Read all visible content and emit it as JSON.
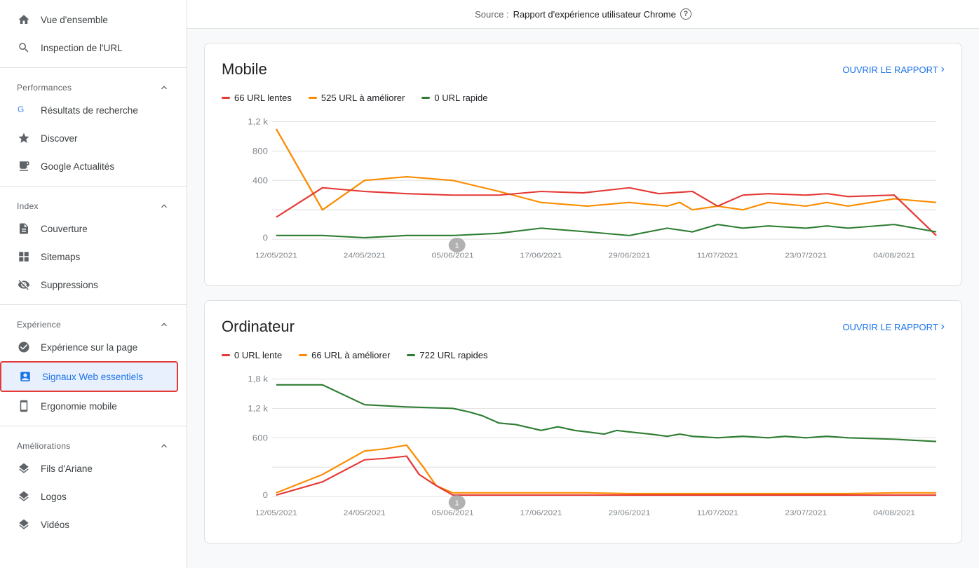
{
  "header": {
    "source_label": "Source :",
    "source_value": "Rapport d'expérience utilisateur Chrome",
    "help": "?"
  },
  "sidebar": {
    "items": [
      {
        "id": "vue-ensemble",
        "label": "Vue d'ensemble",
        "icon": "home",
        "section": null
      },
      {
        "id": "inspection-url",
        "label": "Inspection de l'URL",
        "icon": "search",
        "section": null
      },
      {
        "id": "section-performances",
        "label": "Performances",
        "type": "section"
      },
      {
        "id": "resultats-recherche",
        "label": "Résultats de recherche",
        "icon": "google",
        "section": "performances"
      },
      {
        "id": "discover",
        "label": "Discover",
        "icon": "star",
        "section": "performances"
      },
      {
        "id": "google-actualites",
        "label": "Google Actualités",
        "icon": "news",
        "section": "performances"
      },
      {
        "id": "section-index",
        "label": "Index",
        "type": "section"
      },
      {
        "id": "couverture",
        "label": "Couverture",
        "icon": "doc",
        "section": "index"
      },
      {
        "id": "sitemaps",
        "label": "Sitemaps",
        "icon": "grid",
        "section": "index"
      },
      {
        "id": "suppressions",
        "label": "Suppressions",
        "icon": "eye-off",
        "section": "index"
      },
      {
        "id": "section-experience",
        "label": "Expérience",
        "type": "section"
      },
      {
        "id": "experience-page",
        "label": "Expérience sur la page",
        "icon": "page",
        "section": "experience"
      },
      {
        "id": "signaux-web",
        "label": "Signaux Web essentiels",
        "icon": "vitals",
        "section": "experience",
        "active": true
      },
      {
        "id": "ergonomie-mobile",
        "label": "Ergonomie mobile",
        "icon": "mobile",
        "section": "experience"
      },
      {
        "id": "section-ameliorations",
        "label": "Améliorations",
        "type": "section"
      },
      {
        "id": "fils-ariane",
        "label": "Fils d'Ariane",
        "icon": "layers",
        "section": "ameliorations"
      },
      {
        "id": "logos",
        "label": "Logos",
        "icon": "layers",
        "section": "ameliorations"
      },
      {
        "id": "videos",
        "label": "Vidéos",
        "icon": "layers",
        "section": "ameliorations"
      }
    ]
  },
  "mobile_card": {
    "title": "Mobile",
    "open_report": "OUVRIR LE RAPPORT",
    "legend": [
      {
        "label": "66 URL lentes",
        "color": "#e53935"
      },
      {
        "label": "525 URL à améliorer",
        "color": "#fb8c00"
      },
      {
        "label": "0 URL rapide",
        "color": "#2e7d32"
      }
    ],
    "y_labels": [
      "1,2 k",
      "800",
      "400",
      "0"
    ],
    "x_labels": [
      "12/05/2021",
      "24/05/2021",
      "05/06/2021",
      "17/06/2021",
      "29/06/2021",
      "11/07/2021",
      "23/07/2021",
      "04/08/2021"
    ]
  },
  "desktop_card": {
    "title": "Ordinateur",
    "open_report": "OUVRIR LE RAPPORT",
    "legend": [
      {
        "label": "0 URL lente",
        "color": "#e53935"
      },
      {
        "label": "66 URL à améliorer",
        "color": "#fb8c00"
      },
      {
        "label": "722 URL rapides",
        "color": "#2e7d32"
      }
    ],
    "y_labels": [
      "1,8 k",
      "1,2 k",
      "600",
      "0"
    ],
    "x_labels": [
      "12/05/2021",
      "24/05/2021",
      "05/06/2021",
      "17/06/2021",
      "29/06/2021",
      "11/07/2021",
      "23/07/2021",
      "04/08/2021"
    ]
  }
}
